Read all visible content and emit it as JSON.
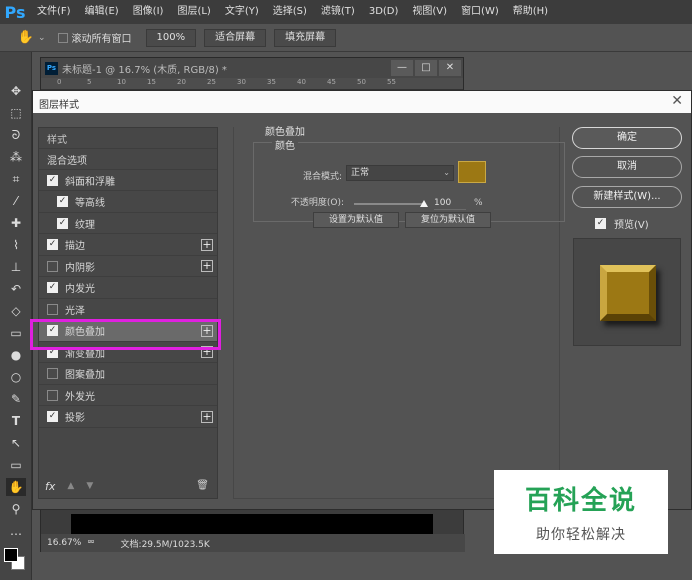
{
  "app": {
    "logo": "Ps",
    "menu": [
      "文件(F)",
      "编辑(E)",
      "图像(I)",
      "图层(L)",
      "文字(Y)",
      "选择(S)",
      "滤镜(T)",
      "3D(D)",
      "视图(V)",
      "窗口(W)",
      "帮助(H)"
    ]
  },
  "options": {
    "scroll_all_windows": "滚动所有窗口",
    "zoom_button": "100%",
    "fit_screen": "适合屏幕",
    "fill_screen": "填充屏幕"
  },
  "document": {
    "logo": "Ps",
    "title": "未标题-1 @ 16.7% (木质, RGB/8) *",
    "ruler_ticks": [
      "0",
      "5",
      "10",
      "15",
      "20",
      "25",
      "30",
      "35",
      "40",
      "45",
      "50",
      "55"
    ],
    "status_zoom": "16.67%",
    "status_doc": "文档:29.5M/1023.5K"
  },
  "dialog": {
    "title": "图层样式",
    "list": {
      "header": "样式",
      "blend_options": "混合选项",
      "items": [
        {
          "label": "斜面和浮雕",
          "checked": true,
          "sub": false,
          "plus": false
        },
        {
          "label": "等高线",
          "checked": true,
          "sub": true,
          "plus": false
        },
        {
          "label": "纹理",
          "checked": true,
          "sub": true,
          "plus": false
        },
        {
          "label": "描边",
          "checked": true,
          "sub": false,
          "plus": true
        },
        {
          "label": "内阴影",
          "checked": false,
          "sub": false,
          "plus": true
        },
        {
          "label": "内发光",
          "checked": true,
          "sub": false,
          "plus": false
        },
        {
          "label": "光泽",
          "checked": false,
          "sub": false,
          "plus": false
        },
        {
          "label": "颜色叠加",
          "checked": true,
          "sub": false,
          "plus": true
        },
        {
          "label": "渐变叠加",
          "checked": true,
          "sub": false,
          "plus": true
        },
        {
          "label": "图案叠加",
          "checked": false,
          "sub": false,
          "plus": false
        },
        {
          "label": "外发光",
          "checked": false,
          "sub": false,
          "plus": false
        },
        {
          "label": "投影",
          "checked": true,
          "sub": false,
          "plus": true
        }
      ],
      "fx_label": "fx"
    },
    "settings": {
      "title": "颜色叠加",
      "group_title": "颜色",
      "blend_mode_label": "混合模式:",
      "blend_mode_value": "正常",
      "overlay_color": "#9c7814",
      "opacity_label": "不透明度(O):",
      "opacity_value": "100",
      "opacity_unit": "%",
      "opacity_fraction": 1.0,
      "set_default": "设置为默认值",
      "reset_default": "复位为默认值"
    },
    "buttons": {
      "ok": "确定",
      "cancel": "取消",
      "new_style": "新建样式(W)...",
      "preview": "预览(V)"
    }
  },
  "watermark": {
    "title": "百科全说",
    "subtitle": "助你轻松解决"
  }
}
